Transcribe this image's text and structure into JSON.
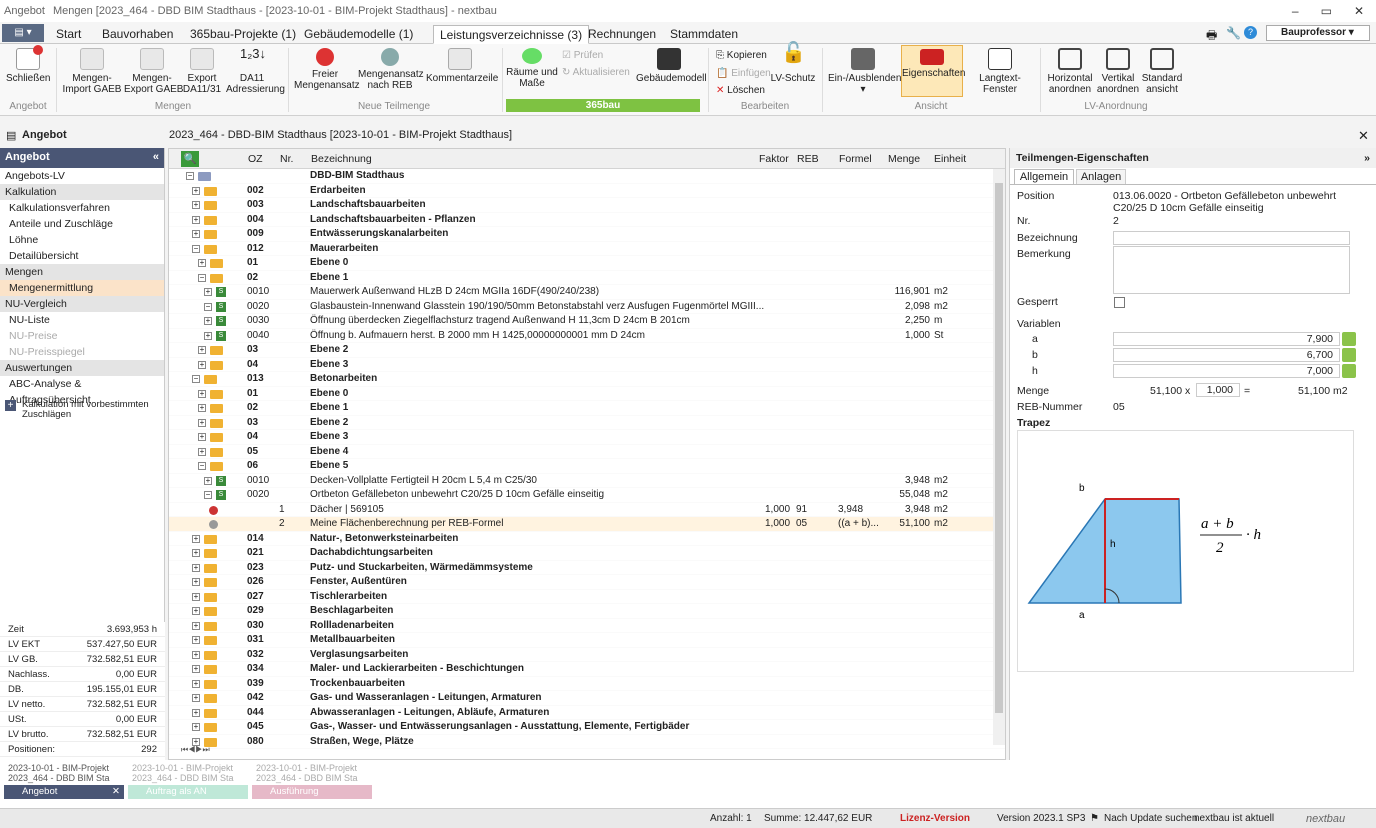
{
  "titlebar": {
    "app": "Angebot",
    "project": "Mengen [2023_464 - DBD BIM Stadthaus - [2023-10-01 - BIM-Projekt Stadthaus] - nextbau"
  },
  "tabs": [
    "Start",
    "Bauvorhaben",
    "365bau-Projekte (1)",
    "Gebäudemodelle (1)",
    "Leistungsverzeichnisse (3)",
    "Rechnungen",
    "Stammdaten"
  ],
  "user": "Bauprofessor",
  "ribbon": {
    "schliessen": "Schließen",
    "mengen_import": "Mengen-\nImport GAEB",
    "mengen_export": "Mengen-\nExport GAEB",
    "export_da": "Export\nDA11/31",
    "da11": "DA11\nAdressierung",
    "freier": "Freier\nMengenansatz",
    "mengenansatz_reb": "Mengenansatz\nnach REB",
    "kommentar": "Kommentarzeile",
    "raeume": "Räume und\nMaße",
    "pruefen": "Prüfen",
    "aktualisieren": "Aktualisieren",
    "gebaeudemodell": "Gebäudemodell",
    "band365": "365bau",
    "kopieren": "Kopieren",
    "einfuegen": "Einfügen",
    "loeschen": "Löschen",
    "lvschutz": "LV-Schutz",
    "einaus": "Ein-/Ausblenden",
    "eigenschaften": "Eigenschaften",
    "langtext": "Langtext-Fenster",
    "horizontal": "Horizontal\nanordnen",
    "vertikal": "Vertikal\nanordnen",
    "standard": "Standard\nansicht",
    "grp_angebot": "Angebot",
    "grp_mengen": "Mengen",
    "grp_neue": "Neue Teilmenge",
    "grp_bearbeiten": "Bearbeiten",
    "grp_ansicht": "Ansicht",
    "grp_lv": "LV-Anordnung"
  },
  "panel_title": "Angebot",
  "breadcrumb": "2023_464 - DBD-BIM Stadthaus [2023-10-01 - BIM-Projekt Stadthaus]",
  "left": {
    "header": "Angebot",
    "items": [
      {
        "t": "Angebots-LV",
        "c": ""
      },
      {
        "t": "Kalkulation",
        "c": "sec"
      },
      {
        "t": "Kalkulationsverfahren",
        "c": "sub"
      },
      {
        "t": "Anteile und Zuschläge",
        "c": "sub"
      },
      {
        "t": "Löhne",
        "c": "sub"
      },
      {
        "t": "Detailübersicht",
        "c": "sub"
      },
      {
        "t": "Mengen",
        "c": "sec"
      },
      {
        "t": "Mengenermittlung",
        "c": "sub sel"
      },
      {
        "t": "NU-Vergleich",
        "c": "sec"
      },
      {
        "t": "NU-Liste",
        "c": "sub"
      },
      {
        "t": "NU-Preise",
        "c": "sub dis"
      },
      {
        "t": "NU-Preisspiegel",
        "c": "sub dis"
      },
      {
        "t": "Auswertungen",
        "c": "sec"
      },
      {
        "t": "ABC-Analyse & Auftragsübersicht",
        "c": "sub"
      }
    ],
    "calc": "Kalkulation mit vorbestimmten Zuschlägen"
  },
  "stats": [
    [
      "Zeit",
      "3.693,953 h"
    ],
    [
      "LV EKT",
      "537.427,50 EUR"
    ],
    [
      "LV GB.",
      "732.582,51 EUR"
    ],
    [
      "Nachlass.",
      "0,00 EUR"
    ],
    [
      "DB.",
      "195.155,01 EUR"
    ],
    [
      "LV netto.",
      "732.582,51 EUR"
    ],
    [
      "USt.",
      "0,00 EUR"
    ],
    [
      "LV brutto.",
      "732.582,51 EUR"
    ],
    [
      "Positionen:",
      "292"
    ]
  ],
  "grid": {
    "cols": [
      "OZ",
      "Nr.",
      "Bezeichnung",
      "Faktor",
      "REB",
      "Formel",
      "Menge",
      "Einheit"
    ],
    "rows": [
      {
        "l": 0,
        "oz": "",
        "bz": "DBD-BIM Stadthaus",
        "b": 1,
        "k": "root"
      },
      {
        "l": 1,
        "oz": "002",
        "bz": "Erdarbeiten",
        "b": 1,
        "k": "f"
      },
      {
        "l": 1,
        "oz": "003",
        "bz": "Landschaftsbauarbeiten",
        "b": 1,
        "k": "f"
      },
      {
        "l": 1,
        "oz": "004",
        "bz": "Landschaftsbauarbeiten - Pflanzen",
        "b": 1,
        "k": "f"
      },
      {
        "l": 1,
        "oz": "009",
        "bz": "Entwässerungskanalarbeiten",
        "b": 1,
        "k": "f"
      },
      {
        "l": 1,
        "oz": "012",
        "bz": "Mauerarbeiten",
        "b": 1,
        "k": "fo"
      },
      {
        "l": 2,
        "oz": "01",
        "bz": "Ebene 0",
        "b": 1,
        "k": "f"
      },
      {
        "l": 2,
        "oz": "02",
        "bz": "Ebene 1",
        "b": 1,
        "k": "fo"
      },
      {
        "l": 3,
        "oz": "0010",
        "bz": "Mauerwerk Außenwand HLzB D 24cm MGIIa 16DF(490/240/238)",
        "m": "116,901",
        "e": "m2",
        "k": "p"
      },
      {
        "l": 3,
        "oz": "0020",
        "bz": "Glasbaustein-Innenwand Glasstein 190/190/50mm Betonstabstahl verz Ausfugen Fugenmörtel MGIII...",
        "m": "2,098",
        "e": "m2",
        "k": "p"
      },
      {
        "l": 3,
        "oz": "0030",
        "bz": "Öffnung überdecken Ziegelflachsturz tragend Außenwand H 11,3cm D 24cm B 201cm",
        "m": "2,250",
        "e": "m",
        "k": "p"
      },
      {
        "l": 3,
        "oz": "0040",
        "bz": "Öffnung b. Aufmauern herst. B 2000 mm H 1425,00000000001 mm D 24cm",
        "m": "1,000",
        "e": "St",
        "k": "p"
      },
      {
        "l": 2,
        "oz": "03",
        "bz": "Ebene 2",
        "b": 1,
        "k": "f"
      },
      {
        "l": 2,
        "oz": "04",
        "bz": "Ebene 3",
        "b": 1,
        "k": "f"
      },
      {
        "l": 1,
        "oz": "013",
        "bz": "Betonarbeiten",
        "b": 1,
        "k": "fo"
      },
      {
        "l": 2,
        "oz": "01",
        "bz": "Ebene 0",
        "b": 1,
        "k": "f"
      },
      {
        "l": 2,
        "oz": "02",
        "bz": "Ebene 1",
        "b": 1,
        "k": "f"
      },
      {
        "l": 2,
        "oz": "03",
        "bz": "Ebene 2",
        "b": 1,
        "k": "f"
      },
      {
        "l": 2,
        "oz": "04",
        "bz": "Ebene 3",
        "b": 1,
        "k": "f"
      },
      {
        "l": 2,
        "oz": "05",
        "bz": "Ebene 4",
        "b": 1,
        "k": "f"
      },
      {
        "l": 2,
        "oz": "06",
        "bz": "Ebene 5",
        "b": 1,
        "k": "fo"
      },
      {
        "l": 3,
        "oz": "0010",
        "bz": "Decken-Vollplatte Fertigteil H 20cm L 5,4 m C25/30",
        "m": "3,948",
        "e": "m2",
        "k": "p"
      },
      {
        "l": 3,
        "oz": "0020",
        "bz": "Ortbeton Gefällebeton unbewehrt C20/25 D 10cm Gefälle einseitig",
        "m": "55,048",
        "e": "m2",
        "k": "p"
      },
      {
        "l": 4,
        "nr": "1",
        "bz": "Dächer | 569105",
        "fa": "1,000",
        "rb": "91",
        "fo": "3,948",
        "m": "3,948",
        "e": "m2",
        "k": "t"
      },
      {
        "l": 4,
        "nr": "2",
        "bz": "Meine Flächenberechnung per REB-Formel",
        "fa": "1,000",
        "rb": "05",
        "fo": "((a + b)...",
        "m": "51,100",
        "e": "m2",
        "k": "t",
        "s": 1
      },
      {
        "l": 1,
        "oz": "014",
        "bz": "Natur-, Betonwerksteinarbeiten",
        "b": 1,
        "k": "f"
      },
      {
        "l": 1,
        "oz": "021",
        "bz": "Dachabdichtungsarbeiten",
        "b": 1,
        "k": "f"
      },
      {
        "l": 1,
        "oz": "023",
        "bz": "Putz- und Stuckarbeiten, Wärmedämmsysteme",
        "b": 1,
        "k": "f"
      },
      {
        "l": 1,
        "oz": "026",
        "bz": "Fenster, Außentüren",
        "b": 1,
        "k": "f"
      },
      {
        "l": 1,
        "oz": "027",
        "bz": "Tischlerarbeiten",
        "b": 1,
        "k": "f"
      },
      {
        "l": 1,
        "oz": "029",
        "bz": "Beschlagarbeiten",
        "b": 1,
        "k": "f"
      },
      {
        "l": 1,
        "oz": "030",
        "bz": "Rollladenarbeiten",
        "b": 1,
        "k": "f"
      },
      {
        "l": 1,
        "oz": "031",
        "bz": "Metallbauarbeiten",
        "b": 1,
        "k": "f"
      },
      {
        "l": 1,
        "oz": "032",
        "bz": "Verglasungsarbeiten",
        "b": 1,
        "k": "f"
      },
      {
        "l": 1,
        "oz": "034",
        "bz": "Maler- und Lackierarbeiten - Beschichtungen",
        "b": 1,
        "k": "f"
      },
      {
        "l": 1,
        "oz": "039",
        "bz": "Trockenbauarbeiten",
        "b": 1,
        "k": "f"
      },
      {
        "l": 1,
        "oz": "042",
        "bz": "Gas- und Wasseranlagen - Leitungen, Armaturen",
        "b": 1,
        "k": "f"
      },
      {
        "l": 1,
        "oz": "044",
        "bz": "Abwasseranlagen - Leitungen, Abläufe, Armaturen",
        "b": 1,
        "k": "f"
      },
      {
        "l": 1,
        "oz": "045",
        "bz": "Gas-, Wasser- und Entwässerungsanlagen - Ausstattung, Elemente, Fertigbäder",
        "b": 1,
        "k": "f"
      },
      {
        "l": 1,
        "oz": "080",
        "bz": "Straßen, Wege, Plätze",
        "b": 1,
        "k": "f"
      }
    ]
  },
  "props": {
    "title": "Teilmengen-Eigenschaften",
    "tab1": "Allgemein",
    "tab2": "Anlagen",
    "position_l": "Position",
    "position_v": "013.06.0020 - Ortbeton Gefällebeton unbewehrt C20/25 D 10cm Gefälle einseitig",
    "nr_l": "Nr.",
    "nr_v": "2",
    "bez_l": "Bezeichnung",
    "bem_l": "Bemerkung",
    "gesperrt_l": "Gesperrt",
    "var_l": "Variablen",
    "vars": [
      [
        "a",
        "7,900"
      ],
      [
        "b",
        "6,700"
      ],
      [
        "h",
        "7,000"
      ]
    ],
    "menge_l": "Menge",
    "menge_a": "51,100 x",
    "menge_f": "1,000",
    "menge_eq": "=",
    "menge_r": "51,100 m2",
    "reb_l": "REB-Nummer",
    "reb_v": "05",
    "trapez": "Trapez",
    "lab_b": "b",
    "lab_h": "h",
    "lab_a": "a"
  },
  "bottom": {
    "doc1a": "2023-10-01 - BIM-Projekt",
    "doc1b": "2023_464 - DBD BIM Sta",
    "doc2a": "2023-10-01 - BIM-Projekt",
    "doc2b": "2023_464 - DBD BIM Sta",
    "doc3a": "2023-10-01 - BIM-Projekt",
    "doc3b": "2023_464 - DBD BIM Sta",
    "t1": "Angebot",
    "t2": "Auftrag als AN",
    "t3": "Ausführung"
  },
  "status": {
    "anzahl": "Anzahl: 1",
    "summe": "Summe: 12.447,62 EUR",
    "lizenz": "Lizenz-Version",
    "version": "Version 2023.1 SP3",
    "update": "Nach Update suchen",
    "aktuell": "nextbau ist aktuell",
    "brand": "nextbau"
  }
}
